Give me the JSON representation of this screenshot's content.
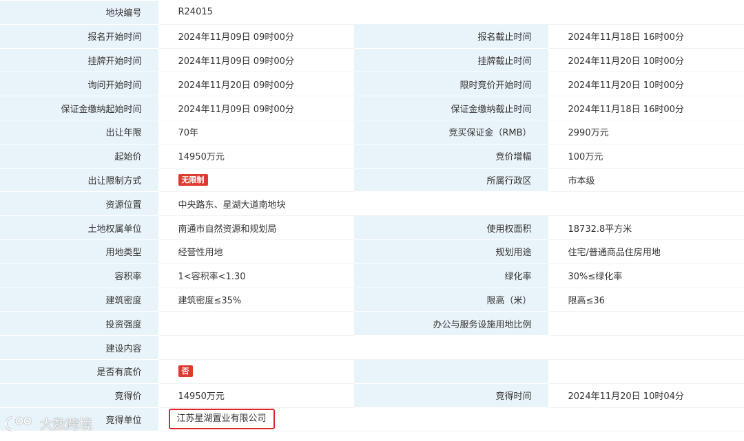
{
  "rows": [
    {
      "l1": "地块编号",
      "v1": "R24015",
      "full": true
    },
    {
      "l1": "报名开始时间",
      "v1": "2024年11月09日 09时00分",
      "l2": "报名截止时间",
      "v2": "2024年11月18日 16时00分"
    },
    {
      "l1": "挂牌开始时间",
      "v1": "2024年11月09日 09时00分",
      "l2": "挂牌截止时间",
      "v2": "2024年11月20日 10时00分"
    },
    {
      "l1": "询问开始时间",
      "v1": "2024年11月20日 09时00分",
      "l2": "限时竞价开始时间",
      "v2": "2024年11月20日 10时00分"
    },
    {
      "l1": "保证金缴纳起始时间",
      "v1": "2024年11月09日 09时00分",
      "l2": "保证金缴纳截止时间",
      "v2": "2024年11月18日 16时00分"
    },
    {
      "l1": "出让年限",
      "v1": "70年",
      "l2": "竞买保证金（RMB）",
      "v2": "2990万元"
    },
    {
      "l1": "起始价",
      "v1": "14950万元",
      "l2": "竞价增幅",
      "v2": "100万元"
    },
    {
      "l1": "出让限制方式",
      "v1": "无限制",
      "l2": "所属行政区",
      "v2": "市本级"
    },
    {
      "l1": "资源位置",
      "v1": "中央路东、星湖大道南地块",
      "full": true
    },
    {
      "l1": "土地权属单位",
      "v1": "南通市自然资源和规划局",
      "l2": "使用权面积",
      "v2": "18732.8平方米"
    },
    {
      "l1": "用地类型",
      "v1": "经营性用地",
      "l2": "规划用途",
      "v2": "住宅/普通商品住房用地"
    },
    {
      "l1": "容积率",
      "v1": "1<容积率<1.30",
      "l2": "绿化率",
      "v2": "30%≤绿化率"
    },
    {
      "l1": "建筑密度",
      "v1": "建筑密度≤35%",
      "l2": "限高（米）",
      "v2": "限高≤36"
    },
    {
      "l1": "投资强度",
      "v1": "",
      "l2": "办公与服务设施用地比例",
      "v2": ""
    },
    {
      "l1": "建设内容",
      "v1": "",
      "full": true
    },
    {
      "l1": "是否有底价",
      "v1": "否",
      "l2": "",
      "v2": ""
    },
    {
      "l1": "竞得价",
      "v1": "14950万元",
      "l2": "竞得时间",
      "v2": "2024年11月20日 10时04分"
    },
    {
      "l1": "竞得单位",
      "v1": "江苏星湖置业有限公司",
      "l2": "",
      "v2": ""
    }
  ],
  "watermark": {
    "text": "大数跨境"
  },
  "colors": {
    "label_bg": "#e8f3fa",
    "badge_red": "#dc3b2f",
    "highlight_border": "#e0242a"
  }
}
